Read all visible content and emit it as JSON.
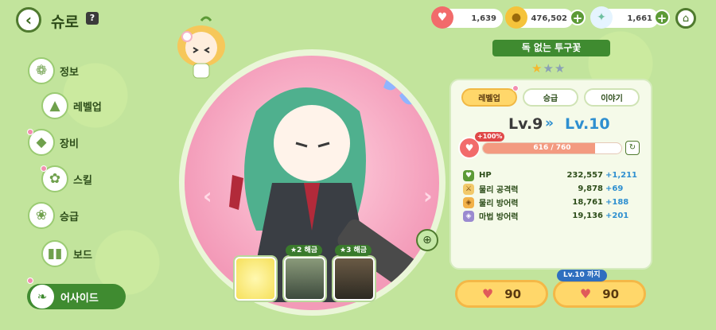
{
  "header": {
    "title": "슈로",
    "help_label": "?"
  },
  "resources": [
    {
      "name": "heart-ticket",
      "icon": "heart-badge-icon",
      "value": "1,639"
    },
    {
      "name": "coin",
      "icon": "coin-icon",
      "value": "476,502"
    },
    {
      "name": "crystal",
      "icon": "crystal-icon",
      "value": "1,661"
    }
  ],
  "sidebar": {
    "items": [
      {
        "id": "info",
        "label": "정보"
      },
      {
        "id": "levelup",
        "label": "레벨업"
      },
      {
        "id": "equip",
        "label": "장비"
      },
      {
        "id": "skill",
        "label": "스킬"
      },
      {
        "id": "promote",
        "label": "승급"
      },
      {
        "id": "board",
        "label": "보드"
      },
      {
        "id": "aside",
        "label": "어사이드"
      }
    ]
  },
  "skins": {
    "lock2": "★2 해금",
    "lock3": "★3 해금"
  },
  "character": {
    "name": "독 없는 투구꽃",
    "stars_filled": 1,
    "stars_total": 3
  },
  "tabs": [
    {
      "label": "레벨업",
      "active": true
    },
    {
      "label": "승급",
      "active": false
    },
    {
      "label": "이야기",
      "active": false
    }
  ],
  "level": {
    "current": "Lv.9",
    "arrow": "»",
    "next": "Lv.10",
    "bonus": "+100%",
    "xp_text": "616 / 760",
    "xp_fraction": 0.81
  },
  "stats": [
    {
      "icon": "heart-icon",
      "name": "HP",
      "value": "232,557",
      "inc": "+1,211"
    },
    {
      "icon": "sword-icon",
      "name": "물리 공격력",
      "value": "9,878",
      "inc": "+69"
    },
    {
      "icon": "shield-icon",
      "name": "물리 방어력",
      "value": "18,761",
      "inc": "+188"
    },
    {
      "icon": "magic-shield-icon",
      "name": "마법 방어력",
      "value": "19,136",
      "inc": "+201"
    }
  ],
  "costs": {
    "single": "90",
    "max": "90",
    "max_tip": "Lv.10 까지"
  },
  "colors": {
    "accent": "#3f8b30",
    "stage": "#f39ab8",
    "increase": "#2e8fd0"
  }
}
